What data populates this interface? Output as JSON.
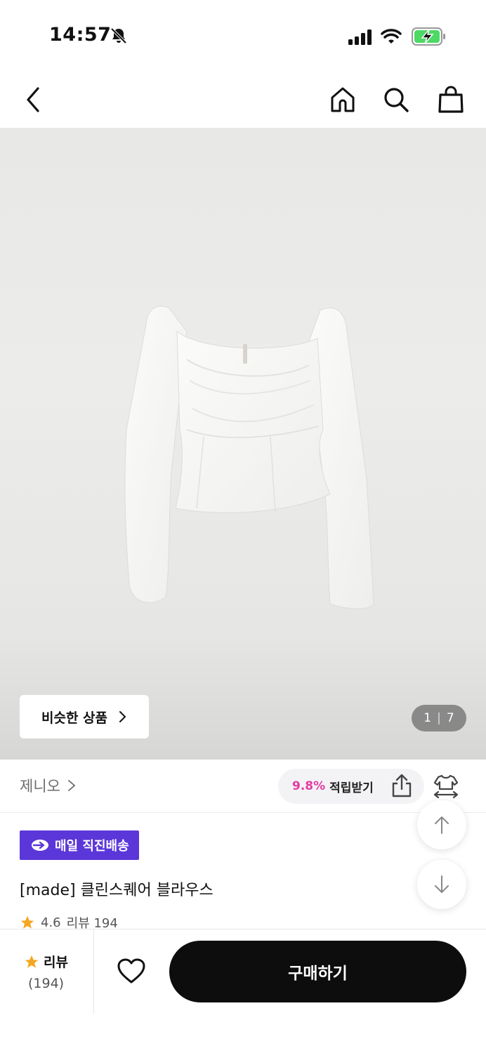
{
  "status_bar": {
    "time": "14:57",
    "icons": [
      "bell-off-icon",
      "signal-icon",
      "wifi-icon",
      "battery-charging-icon"
    ]
  },
  "nav": {
    "icons": [
      "back-icon",
      "home-icon",
      "search-icon",
      "shopping-bag-icon"
    ]
  },
  "gallery": {
    "similar_label": "비슷한 상품",
    "current_page": "1",
    "separator": "|",
    "total_pages": "7"
  },
  "brand": {
    "name": "제니오",
    "points_rate": "9.8%",
    "points_label": "적립받기"
  },
  "product": {
    "delivery_badge": "매일 직진배송",
    "title": "[made] 클린스퀘어 블라우스",
    "rating": "4.6",
    "review_label": "리뷰 194"
  },
  "bottom_bar": {
    "review_label": "리뷰",
    "review_count": "(194)",
    "buy_label": "구매하기"
  },
  "colors": {
    "accent_purple": "#5b37d9",
    "points_pink": "#e53aa3",
    "star_orange": "#f5a623",
    "buy_button": "#0d0d0d"
  }
}
